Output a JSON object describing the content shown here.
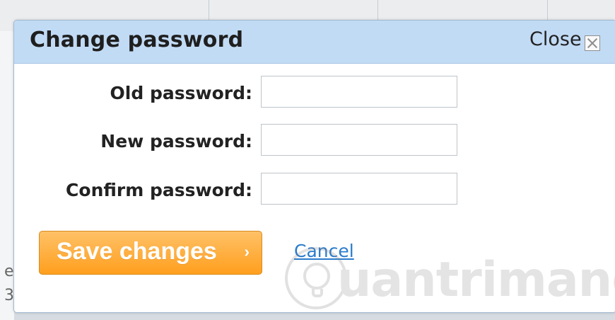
{
  "modal": {
    "title": "Change password",
    "close_label": "Close"
  },
  "form": {
    "old_password_label": "Old password:",
    "new_password_label": "New password:",
    "confirm_password_label": "Confirm password:",
    "old_password_value": "",
    "new_password_value": "",
    "confirm_password_value": ""
  },
  "actions": {
    "save_label": "Save changes",
    "save_arrow": "›",
    "cancel_label": "Cancel"
  },
  "background": {
    "left_letters": [
      "e",
      "3"
    ]
  },
  "watermark": {
    "text": "uantrimang"
  },
  "colors": {
    "header_bg": "#c2dbf5",
    "save_button": "#ff9f1e",
    "cancel_link": "#2a7ccc"
  },
  "icons": {
    "close": "close-icon"
  }
}
